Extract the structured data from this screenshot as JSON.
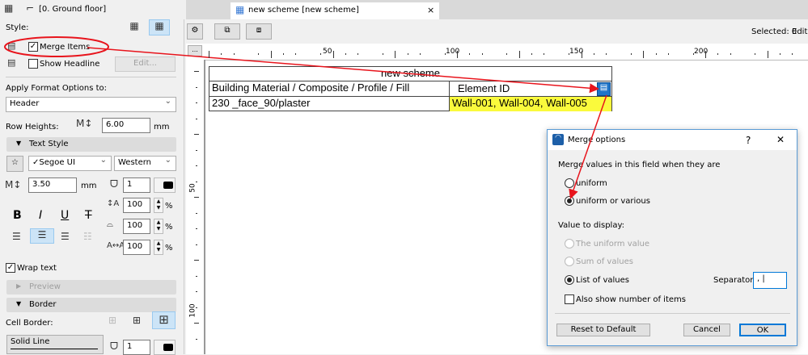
{
  "header": {
    "floor_label": "[0. Ground floor]"
  },
  "tab": {
    "title": "new scheme [new scheme]",
    "close": "×"
  },
  "toolbar": {
    "selected": "Selected: 0",
    "edit": "Edit"
  },
  "ruler": {
    "h_labels": [
      "50",
      "100",
      "150",
      "200"
    ],
    "v_labels": [
      "50",
      "100"
    ],
    "more": "..."
  },
  "panel": {
    "style_label": "Style:",
    "merge_items": "Merge Items",
    "merge_checked": true,
    "show_headline": "Show Headline",
    "show_headline_checked": false,
    "edit_button": "Edit...",
    "apply_label": "Apply Format Options to:",
    "apply_value": "Header",
    "row_heights_label": "Row Heights:",
    "row_heights_value": "6.00",
    "row_heights_unit": "mm",
    "text_style": "Text Style",
    "font": "✓Segoe UI",
    "script": "Western",
    "font_size": "3.50",
    "font_size_unit": "mm",
    "pen": "1",
    "spacing": [
      {
        "value": "100",
        "unit": "%"
      },
      {
        "value": "100",
        "unit": "%"
      },
      {
        "value": "100",
        "unit": "%"
      }
    ],
    "bold": "B",
    "italic": "I",
    "underline": "U",
    "strike": "T",
    "wrap_text": "Wrap text",
    "wrap_checked": true,
    "preview": "Preview",
    "border": "Border",
    "cell_border_label": "Cell Border:",
    "line_type": "Solid Line",
    "border_pen": "1"
  },
  "schedule": {
    "title": "new scheme",
    "headers": [
      "Building Material / Composite / Profile / Fill",
      "Element ID"
    ],
    "row": [
      "230 _face_90/plaster",
      "Wall-001, Wall-004, Wall-005"
    ]
  },
  "dialog": {
    "title": "Merge options",
    "help": "?",
    "close": "✕",
    "merge_label": "Merge values in this field when they are",
    "merge_options": [
      {
        "label": "uniform",
        "selected": false
      },
      {
        "label": "uniform or various",
        "selected": true
      }
    ],
    "display_label": "Value to display:",
    "display_options": [
      {
        "label": "The uniform value",
        "selected": false,
        "disabled": true
      },
      {
        "label": "Sum of values",
        "selected": false,
        "disabled": true
      },
      {
        "label": "List of values",
        "selected": true,
        "disabled": false
      }
    ],
    "separator_label": "Separator",
    "separator_value": ", |",
    "also_show": "Also show number of items",
    "also_show_checked": false,
    "reset": "Reset to Default",
    "cancel": "Cancel",
    "ok": "OK"
  },
  "colors": {
    "annotation": "#e8141c",
    "highlight": "#fafa3c",
    "selected_bg": "#cce4f7",
    "accent": "#0078d7"
  }
}
